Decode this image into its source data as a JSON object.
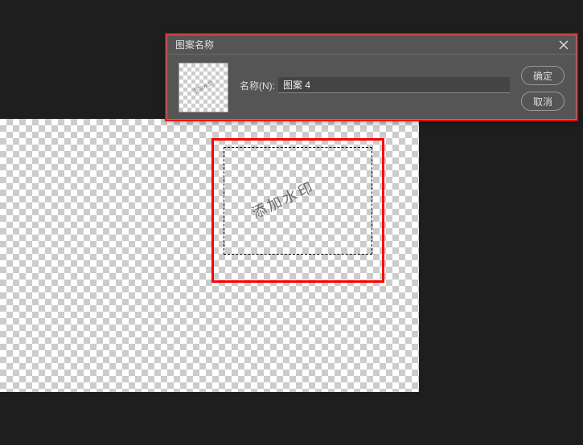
{
  "canvas": {
    "watermark_text": "添加水印"
  },
  "dialog": {
    "title": "图案名称",
    "name_label": "名称(N):",
    "name_value": "图案 4",
    "ok_label": "确定",
    "cancel_label": "取消",
    "preview_hint": "添加水印"
  }
}
